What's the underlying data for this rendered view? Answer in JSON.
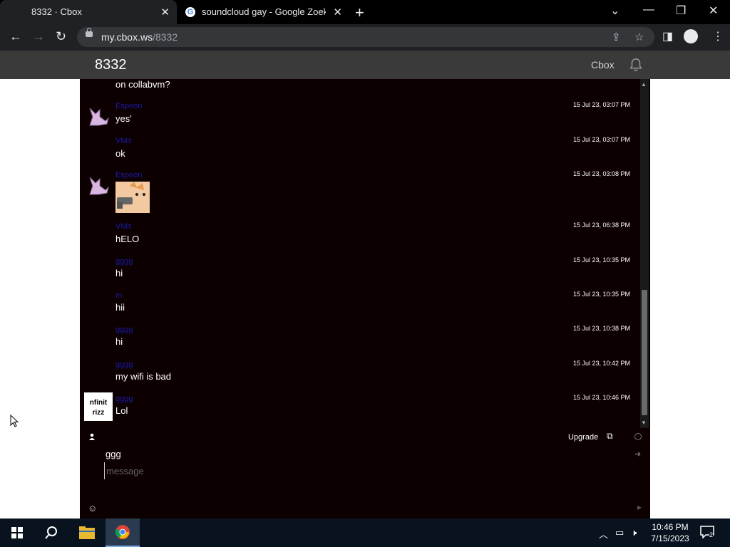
{
  "browser": {
    "tabs": [
      {
        "title": "8332 · Cbox",
        "active": true
      },
      {
        "title": "soundcloud gay - Google Zoeken",
        "active": false
      }
    ],
    "url": {
      "domain": "my.cbox.ws",
      "path": "/8332"
    }
  },
  "header": {
    "box_name": "8332",
    "brand_link": "Cbox"
  },
  "messages": [
    {
      "user": "",
      "text": "on collabvm?",
      "time": ""
    },
    {
      "user": "Espeon",
      "text": "yes'",
      "time": "15 Jul 23, 03:07 PM"
    },
    {
      "user": "VMit",
      "text": "ok",
      "time": "15 Jul 23, 03:07 PM"
    },
    {
      "user": "Espeon",
      "text": "",
      "time": "15 Jul 23, 03:08 PM"
    },
    {
      "user": "VMit",
      "text": "hELO",
      "time": "15 Jul 23, 06:38 PM"
    },
    {
      "user": "gggg",
      "text": "hi",
      "time": "15 Jul 23, 10:35 PM"
    },
    {
      "user": "m",
      "text": "hii",
      "time": "15 Jul 23, 10:35 PM"
    },
    {
      "user": "gggg",
      "text": "hi",
      "time": "15 Jul 23, 10:38 PM"
    },
    {
      "user": "gggg",
      "text": "my wifi is bad",
      "time": "15 Jul 23, 10:42 PM"
    },
    {
      "user": "gggg",
      "text": "Lol",
      "time": "15 Jul 23, 10:46 PM"
    }
  ],
  "avatar_text": {
    "line1": "nfinit",
    "line2": "rizz"
  },
  "compose": {
    "upgrade_label": "Upgrade",
    "name_value": "ggg",
    "message_placeholder": "message"
  },
  "taskbar": {
    "time": "10:46 PM",
    "date": "7/15/2023",
    "notification_count": "2"
  },
  "colors": {
    "chat_bg": "#0d0000",
    "username": "#1a1aa8",
    "header_bg": "#3a3a3a"
  }
}
